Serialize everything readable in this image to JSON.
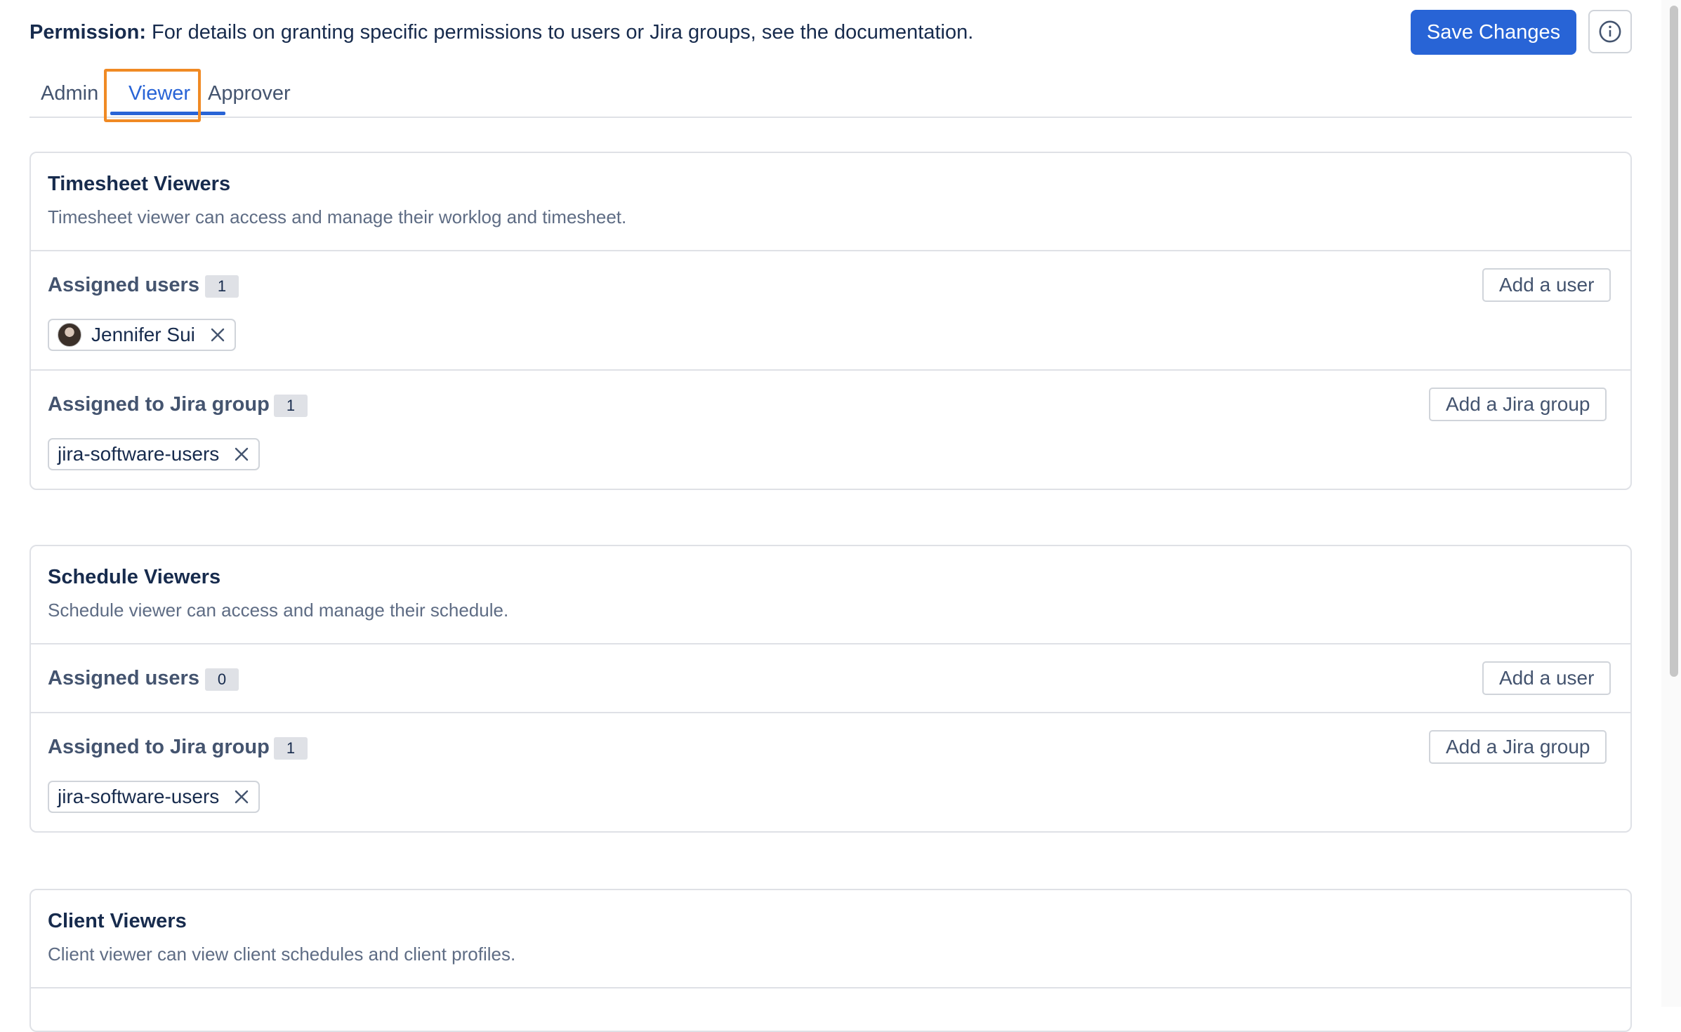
{
  "header": {
    "permission_label": "Permission:",
    "permission_text": " For details on granting specific permissions to users or Jira groups, see the documentation.",
    "save_label": "Save Changes",
    "info_icon": "info-circle-icon"
  },
  "tabs": [
    {
      "label": "Admin",
      "active": false
    },
    {
      "label": "Viewer",
      "active": true
    },
    {
      "label": "Approver",
      "active": false
    }
  ],
  "colors": {
    "accent": "#2864d6",
    "tab_highlight": "#f08a24"
  },
  "cards": [
    {
      "title": "Timesheet Viewers",
      "description": "Timesheet viewer can access and manage their worklog and timesheet.",
      "users": {
        "label": "Assigned users",
        "count": "1",
        "add_label": "Add a user",
        "chips": [
          "Jennifer Sui"
        ]
      },
      "groups": {
        "label": "Assigned to Jira group",
        "count": "1",
        "add_label": "Add a Jira group",
        "chips": [
          "jira-software-users"
        ]
      }
    },
    {
      "title": "Schedule Viewers",
      "description": "Schedule viewer can access and manage their schedule.",
      "users": {
        "label": "Assigned users",
        "count": "0",
        "add_label": "Add a user",
        "chips": []
      },
      "groups": {
        "label": "Assigned to Jira group",
        "count": "1",
        "add_label": "Add a Jira group",
        "chips": [
          "jira-software-users"
        ]
      }
    },
    {
      "title": "Client Viewers",
      "description": "Client viewer can view client schedules and client profiles."
    }
  ]
}
